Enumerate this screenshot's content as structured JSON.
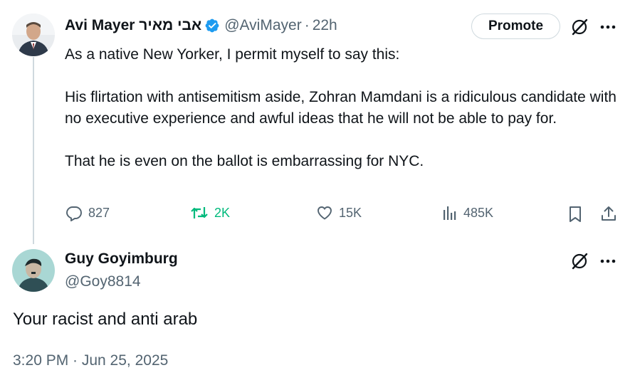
{
  "tweet1": {
    "author_name": "Avi Mayer אבי מאיר",
    "handle": "@AviMayer",
    "separator": "·",
    "time": "22h",
    "promote_label": "Promote",
    "body": [
      "As a native New Yorker, I permit myself to say this:",
      "His flirtation with antisemitism aside, Zohran Mamdani is a ridiculous candidate with no executive experience and awful ideas that he will not be able to pay for.",
      "That he is even on the ballot is embarrassing for NYC."
    ],
    "stats": {
      "replies": "827",
      "reposts": "2K",
      "likes": "15K",
      "views": "485K"
    }
  },
  "tweet2": {
    "author_name": "Guy Goyimburg",
    "handle": "@Goy8814",
    "text": "Your racist and anti arab",
    "timestamp": "3:20 PM · Jun 25, 2025"
  },
  "colors": {
    "text": "#0f1419",
    "secondary": "#536471",
    "verified": "#1d9bf0",
    "repost_active": "#00ba7c",
    "border": "#cfd9de"
  }
}
